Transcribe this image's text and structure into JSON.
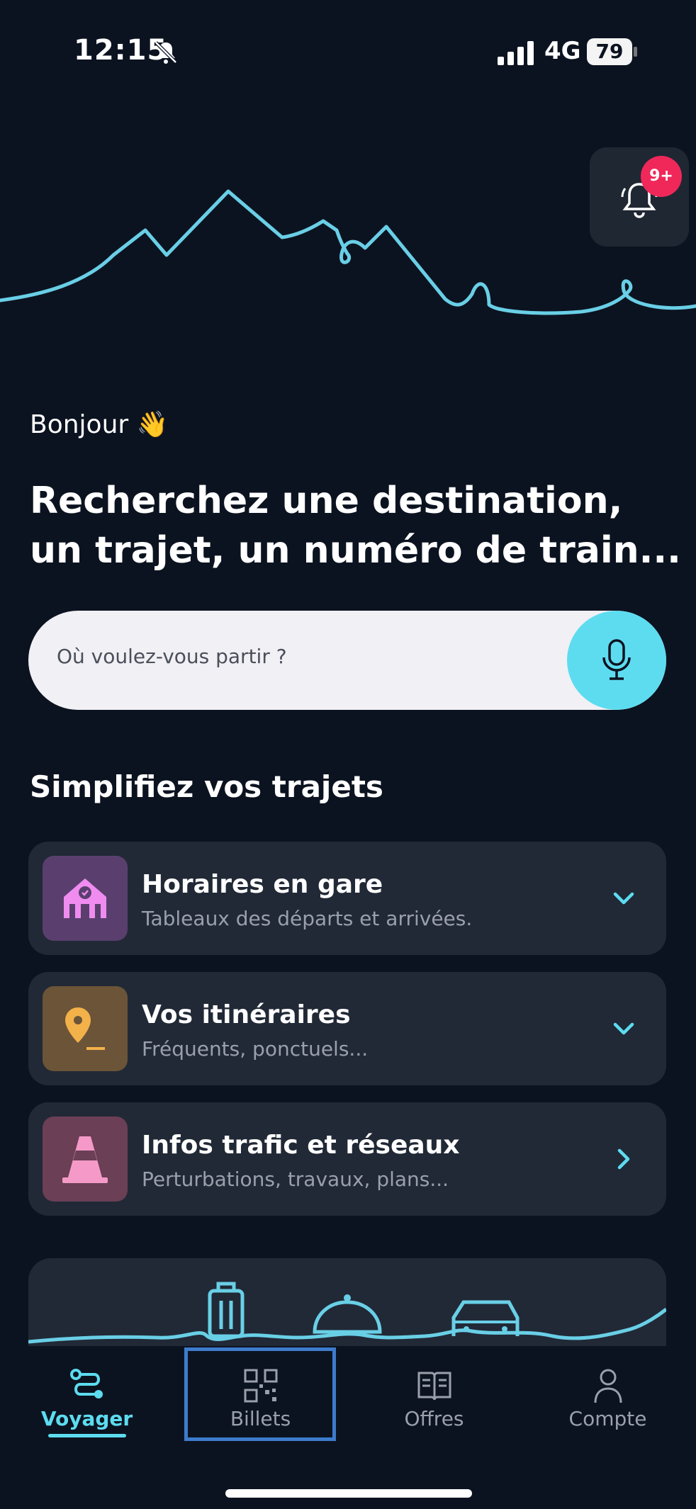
{
  "status_bar": {
    "time": "12:15",
    "network": "4G",
    "battery": "79",
    "icons": [
      "bell-slash-icon",
      "signal-icon",
      "battery-icon"
    ]
  },
  "notifications": {
    "badge": "9+",
    "icon": "bell-icon"
  },
  "greeting": "Bonjour 👋",
  "headline": "Recherchez une destination, un trajet, un numéro de train...",
  "search": {
    "placeholder": "Où voulez-vous partir ?",
    "mic_icon": "microphone-icon"
  },
  "section_title": "Simplifiez vos trajets",
  "cards": [
    {
      "title": "Horaires en gare",
      "subtitle": "Tableaux des départs et arrivées.",
      "icon": "station-icon",
      "chevron": "chevron-down-icon"
    },
    {
      "title": "Vos itinéraires",
      "subtitle": "Fréquents, ponctuels...",
      "icon": "location-pin-icon",
      "chevron": "chevron-down-icon"
    },
    {
      "title": "Infos trafic et réseaux",
      "subtitle": "Perturbations, travaux, plans...",
      "icon": "traffic-cone-icon",
      "chevron": "chevron-right-icon"
    }
  ],
  "tabs": [
    {
      "label": "Voyager",
      "icon": "route-icon",
      "active": true
    },
    {
      "label": "Billets",
      "icon": "qr-code-icon",
      "active": false
    },
    {
      "label": "Offres",
      "icon": "book-icon",
      "active": false
    },
    {
      "label": "Compte",
      "icon": "person-icon",
      "active": false
    }
  ],
  "colors": {
    "background": "#0c1320",
    "accent": "#5ddcf0",
    "card": "#212936",
    "badge": "#f0285a"
  }
}
